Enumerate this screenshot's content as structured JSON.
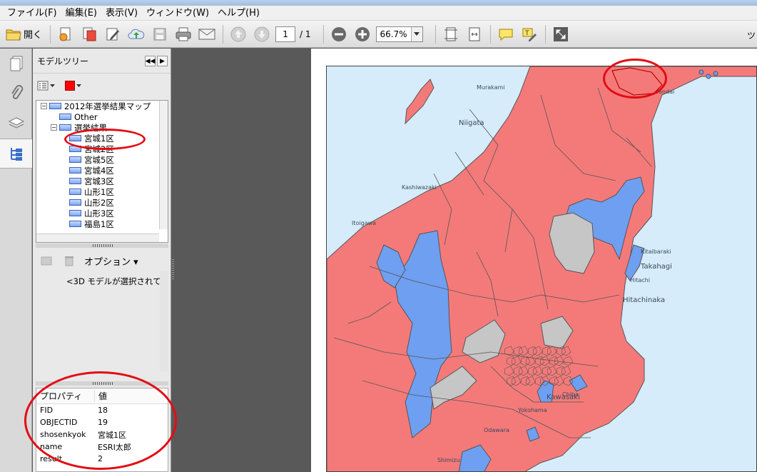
{
  "menu": [
    "ファイル(F)",
    "編集(E)",
    "表示(V)",
    "ウィンドウ(W)",
    "ヘルプ(H)"
  ],
  "toolbar": {
    "open_label": "開く",
    "page_current": "1",
    "page_total": "/ 1",
    "zoom": "66.7%",
    "right_label": "ツ"
  },
  "panel": {
    "title": "モデルツリー",
    "tree": [
      {
        "label": "2012年選挙結果マップ",
        "level": 0,
        "expand": "−"
      },
      {
        "label": "Other",
        "level": 1
      },
      {
        "label": "選挙結果",
        "level": 1,
        "expand": "−"
      },
      {
        "label": "宮城1区",
        "level": 2
      },
      {
        "label": "宮城2区",
        "level": 2
      },
      {
        "label": "宮城5区",
        "level": 2
      },
      {
        "label": "宮城4区",
        "level": 2
      },
      {
        "label": "宮城3区",
        "level": 2
      },
      {
        "label": "山形1区",
        "level": 2
      },
      {
        "label": "山形2区",
        "level": 2
      },
      {
        "label": "山形3区",
        "level": 2
      },
      {
        "label": "福島1区",
        "level": 2
      }
    ],
    "options_label": "オプション",
    "model_message": "<3D モデルが選択されて",
    "props_header": {
      "property": "プロパティ",
      "value": "値"
    },
    "props": [
      {
        "key": "FID",
        "value": "18"
      },
      {
        "key": "OBJECTID",
        "value": "19"
      },
      {
        "key": "shosenkyok",
        "value": "宮城1区"
      },
      {
        "key": "name",
        "value": "ESRI太郎"
      },
      {
        "key": "result",
        "value": "2"
      }
    ]
  },
  "map": {
    "colors": {
      "ldp": "#f47a7a",
      "dpj": "#6e9ff0",
      "other": "#c6c6c6",
      "sea": "#d6ecfa",
      "border": "#555555"
    },
    "labels": [
      "Murakami",
      "Niigata",
      "Sendai",
      "Kashiwazaki",
      "Itoigawa",
      "Kitaibaraki",
      "Takahagi",
      "Hitachi",
      "Hitachinaka",
      "Kawasaki",
      "Yokohama",
      "Odawara",
      "Shimizu",
      "Chiba"
    ]
  },
  "annotation_color": "#e30c14"
}
